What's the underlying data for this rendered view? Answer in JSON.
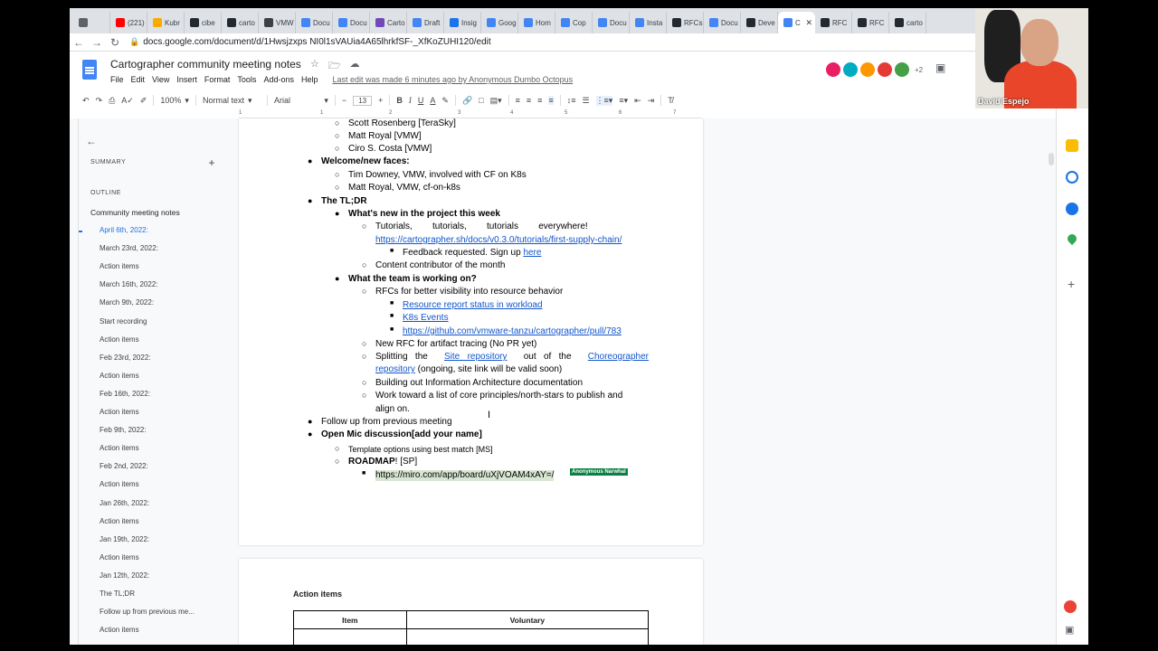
{
  "tabs": [
    {
      "label": "",
      "color": "#5f6368"
    },
    {
      "label": "(221)",
      "color": "#ff0000"
    },
    {
      "label": "Kubr",
      "color": "#f9ab00"
    },
    {
      "label": "cibe",
      "color": "#24292f"
    },
    {
      "label": "carto",
      "color": "#24292f"
    },
    {
      "label": "VMW",
      "color": "#3c4043"
    },
    {
      "label": "Docu",
      "color": "#4285f4"
    },
    {
      "label": "Docu",
      "color": "#4285f4"
    },
    {
      "label": "Carto",
      "color": "#7248b9"
    },
    {
      "label": "Draft",
      "color": "#4285f4"
    },
    {
      "label": "Insig",
      "color": "#1a73e8"
    },
    {
      "label": "Goog",
      "color": "#4285f4"
    },
    {
      "label": "Hom",
      "color": "#4285f4"
    },
    {
      "label": "Cop",
      "color": "#4285f4"
    },
    {
      "label": "Docu",
      "color": "#4285f4"
    },
    {
      "label": "Insta",
      "color": "#4285f4"
    },
    {
      "label": "RFCs",
      "color": "#24292f"
    },
    {
      "label": "Docu",
      "color": "#4285f4"
    },
    {
      "label": "Deve",
      "color": "#24292f"
    },
    {
      "label": "C",
      "color": "#4285f4",
      "active": true
    },
    {
      "label": "RFC",
      "color": "#24292f"
    },
    {
      "label": "RFC",
      "color": "#24292f"
    },
    {
      "label": "carto",
      "color": "#24292f"
    }
  ],
  "address": {
    "url": "docs.google.com/document/d/1Hwsjzxps NI0l1sVAUia4A65lhrkfSF-_XfKoZUHI120/edit"
  },
  "doc_header": {
    "title": "Cartographer community meeting notes",
    "menu": [
      "File",
      "Edit",
      "View",
      "Insert",
      "Format",
      "Tools",
      "Add-ons",
      "Help"
    ],
    "last_edit": "Last edit was made 6 minutes ago by Anonymous Dumbo Octopus",
    "collaborator_colors": [
      "#e91e63",
      "#00acc1",
      "#ff9800",
      "#e53935",
      "#43a047"
    ],
    "collaborator_more": "+2"
  },
  "toolbar": {
    "zoom": "100%",
    "style": "Normal text",
    "font": "Arial",
    "font_size": "13"
  },
  "ruler": [
    "1",
    "1",
    "2",
    "3",
    "4",
    "5",
    "6",
    "7"
  ],
  "outline": {
    "summary_label": "SUMMARY",
    "outline_label": "OUTLINE",
    "items": [
      {
        "text": "Community meeting notes",
        "level": "h1"
      },
      {
        "text": "April 6th, 2022:",
        "level": "h2",
        "current": true
      },
      {
        "text": "March 23rd, 2022:",
        "level": "h2"
      },
      {
        "text": "Action items",
        "level": "h2"
      },
      {
        "text": "March 16th, 2022:",
        "level": "h2"
      },
      {
        "text": "March 9th, 2022:",
        "level": "h2"
      },
      {
        "text": "Start recording",
        "level": "h2"
      },
      {
        "text": "Action items",
        "level": "h2"
      },
      {
        "text": "Feb 23rd, 2022:",
        "level": "h2"
      },
      {
        "text": "Action items",
        "level": "h2"
      },
      {
        "text": "Feb 16th, 2022:",
        "level": "h2"
      },
      {
        "text": "Action items",
        "level": "h2"
      },
      {
        "text": "Feb 9th, 2022:",
        "level": "h2"
      },
      {
        "text": "Action items",
        "level": "h2"
      },
      {
        "text": "Feb 2nd, 2022:",
        "level": "h2"
      },
      {
        "text": "Action items",
        "level": "h2"
      },
      {
        "text": "Jan 26th, 2022:",
        "level": "h2"
      },
      {
        "text": "Action items",
        "level": "h2"
      },
      {
        "text": "Jan 19th, 2022:",
        "level": "h2"
      },
      {
        "text": "Action items",
        "level": "h2"
      },
      {
        "text": "Jan 12th, 2022:",
        "level": "h2"
      },
      {
        "text": "The TL;DR",
        "level": "h2"
      },
      {
        "text": "Follow up from previous me...",
        "level": "h2"
      },
      {
        "text": "Action items",
        "level": "h2"
      }
    ]
  },
  "doc": {
    "attendee_1": "Scott Rosenberg [TeraSky]",
    "attendee_2": "Matt Royal [VMW]",
    "attendee_3": "Ciro S. Costa [VMW]",
    "welcome": "Welcome/new faces:",
    "new_1": "Tim Downey, VMW, involved with CF on K8s",
    "new_2": "Matt Royal, VMW, cf-on-k8s",
    "tldr": "The TL;DR",
    "whats_new": "What's new in the project this week",
    "tutorials": "Tutorials,        tutorials,        tutorials        everywhere!",
    "tutorials_link": "https://cartographer.sh/docs/v0.3.0/tutorials/first-supply-chain/",
    "feedback": "Feedback requested. Sign up",
    "feedback_link": "here",
    "contributor": "Content contributor of the month",
    "team_working": "What the team is working on?",
    "rfcs": "RFCs for better visibility into resource behavior",
    "rfc_link_1": "Resource report status in workload",
    "rfc_link_2": "K8s Events",
    "rfc_link_3": "https://github.com/vmware-tanzu/cartographer/pull/783",
    "new_rfc": "New RFC for artifact tracing (No PR yet)",
    "split_a": "Splitting   the",
    "split_link_1": "Site   repository",
    "split_b": "out   of   the",
    "split_link_2": "Choreographer",
    "split_link_3": "repository",
    "split_c": " (ongoing, site link will be valid soon)",
    "building": "Building out Information Architecture documentation",
    "work_toward_1": "Work toward a list of core principles/north-stars to publish and",
    "work_toward_2": "align on.",
    "follow_up": "Follow up from previous meeting",
    "open_mic": "Open Mic discussion[add your name]",
    "template": "Template options using best match [MS]",
    "roadmap": "ROADMAP",
    "roadmap_tail": "! [SP]",
    "miro_link": "https://miro.com/app/board/uXjVOAM4xAY=/",
    "cursor_label": "Anonymous Narwhal",
    "action_items_title": "Action items",
    "table_headers": [
      "Item",
      "Voluntary"
    ]
  },
  "webcam": {
    "name": "David Espejo"
  }
}
